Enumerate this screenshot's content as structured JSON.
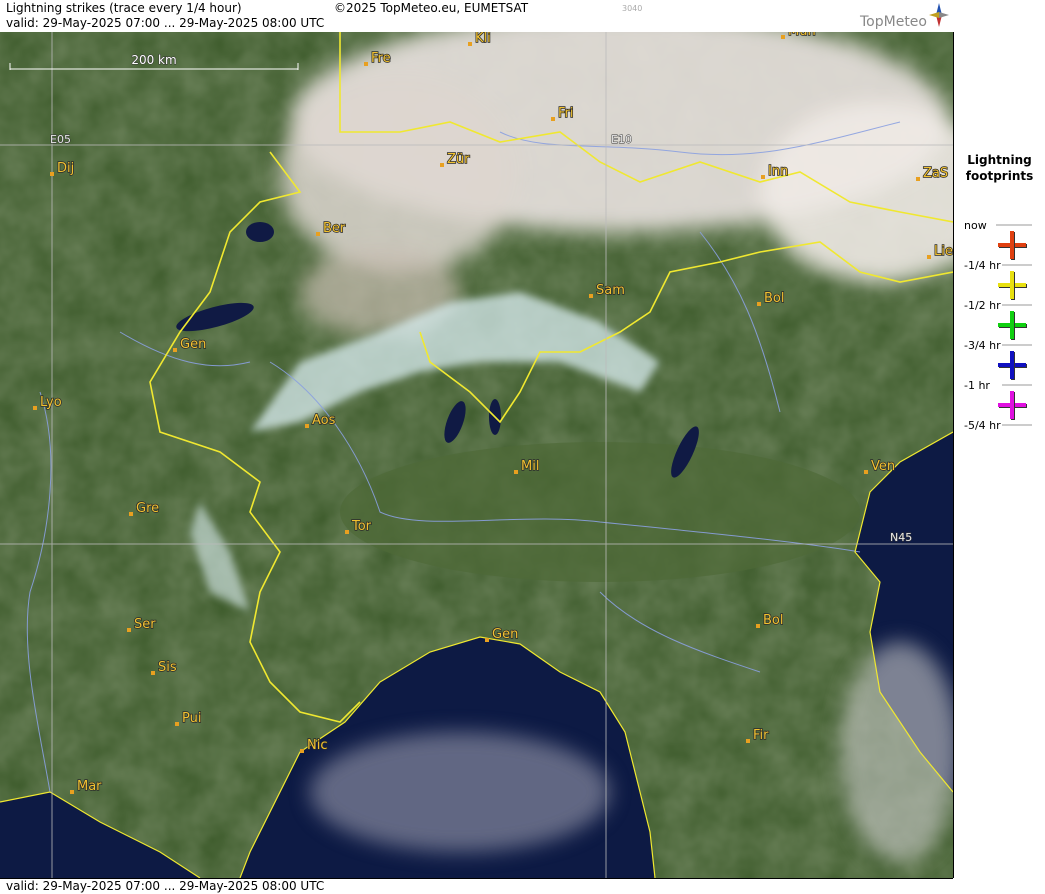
{
  "header": {
    "title": "Lightning strikes (trace every 1/4 hour)",
    "copyright": "©2025 TopMeteo.eu, EUMETSAT",
    "code": "3040",
    "valid_top": "valid:  29-May-2025 07:00 ... 29-May-2025 08:00 UTC",
    "brand": "TopMeteo"
  },
  "footer": {
    "valid_bottom": "valid:  29-May-2025 07:00 ... 29-May-2025 08:00 UTC"
  },
  "map": {
    "scale_label": "200 km",
    "grid_labels": [
      "E05",
      "E10",
      "N45"
    ],
    "cities": [
      "Kli",
      "Mün",
      "Fre",
      "Fri",
      "Zür",
      "Inn",
      "ZaS",
      "Dij",
      "Ber",
      "Lie",
      "Sam",
      "Bol",
      "Gen",
      "Lyo",
      "Aos",
      "Mil",
      "Ven",
      "Gre",
      "Tor",
      "Ser",
      "Gen",
      "Bol",
      "Sis",
      "Pui",
      "Nic",
      "Fir",
      "Mar"
    ],
    "colors": {
      "land": "#3c5a2a",
      "sea": "#0d1a44",
      "border": "#f0e830",
      "river": "#8aa0e0",
      "city_marker": "#e8a020"
    }
  },
  "legend": {
    "title_line1": "Lightning",
    "title_line2": "footprints",
    "rows": [
      {
        "label": "now"
      },
      {
        "label": "-1/4 hr",
        "color": "#e04010"
      },
      {
        "label": "-1/2 hr",
        "color": "#e8e010"
      },
      {
        "label": "-3/4 hr",
        "color": "#10d010"
      },
      {
        "label": "-1 hr",
        "color": "#1010c0"
      },
      {
        "label": "-5/4 hr",
        "color": "#e010e0"
      }
    ]
  }
}
